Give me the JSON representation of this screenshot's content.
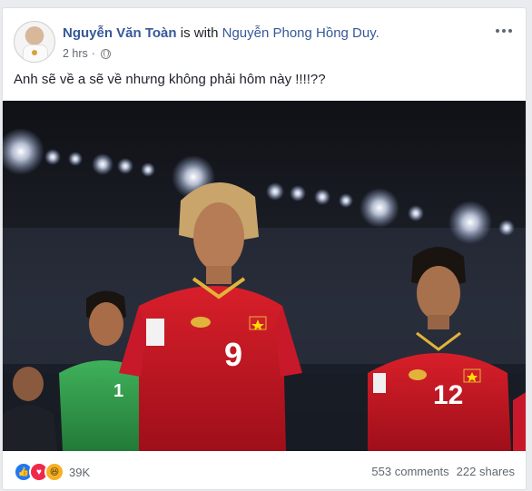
{
  "post": {
    "author": "Nguyễn Văn Toàn",
    "with_text": "is with",
    "tagged": "Nguyễn Phong Hồng Duy.",
    "time": "2 hrs",
    "separator": "·",
    "text": "Anh sẽ về a sẽ về nhưng không phải hôm này !!!!??",
    "privacy_icon": "globe-icon",
    "menu_icon": "more-options-icon"
  },
  "photo": {
    "jersey_numbers": [
      "9",
      "12",
      "1"
    ]
  },
  "footer": {
    "reaction_icons": [
      "like-icon",
      "love-icon",
      "haha-icon"
    ],
    "reaction_count": "39K",
    "comments": "553 comments",
    "shares": "222 shares"
  },
  "colors": {
    "link": "#365899",
    "jersey_red": "#c8102e",
    "keeper_green": "#2f9e48",
    "background": "#e9ebee"
  }
}
